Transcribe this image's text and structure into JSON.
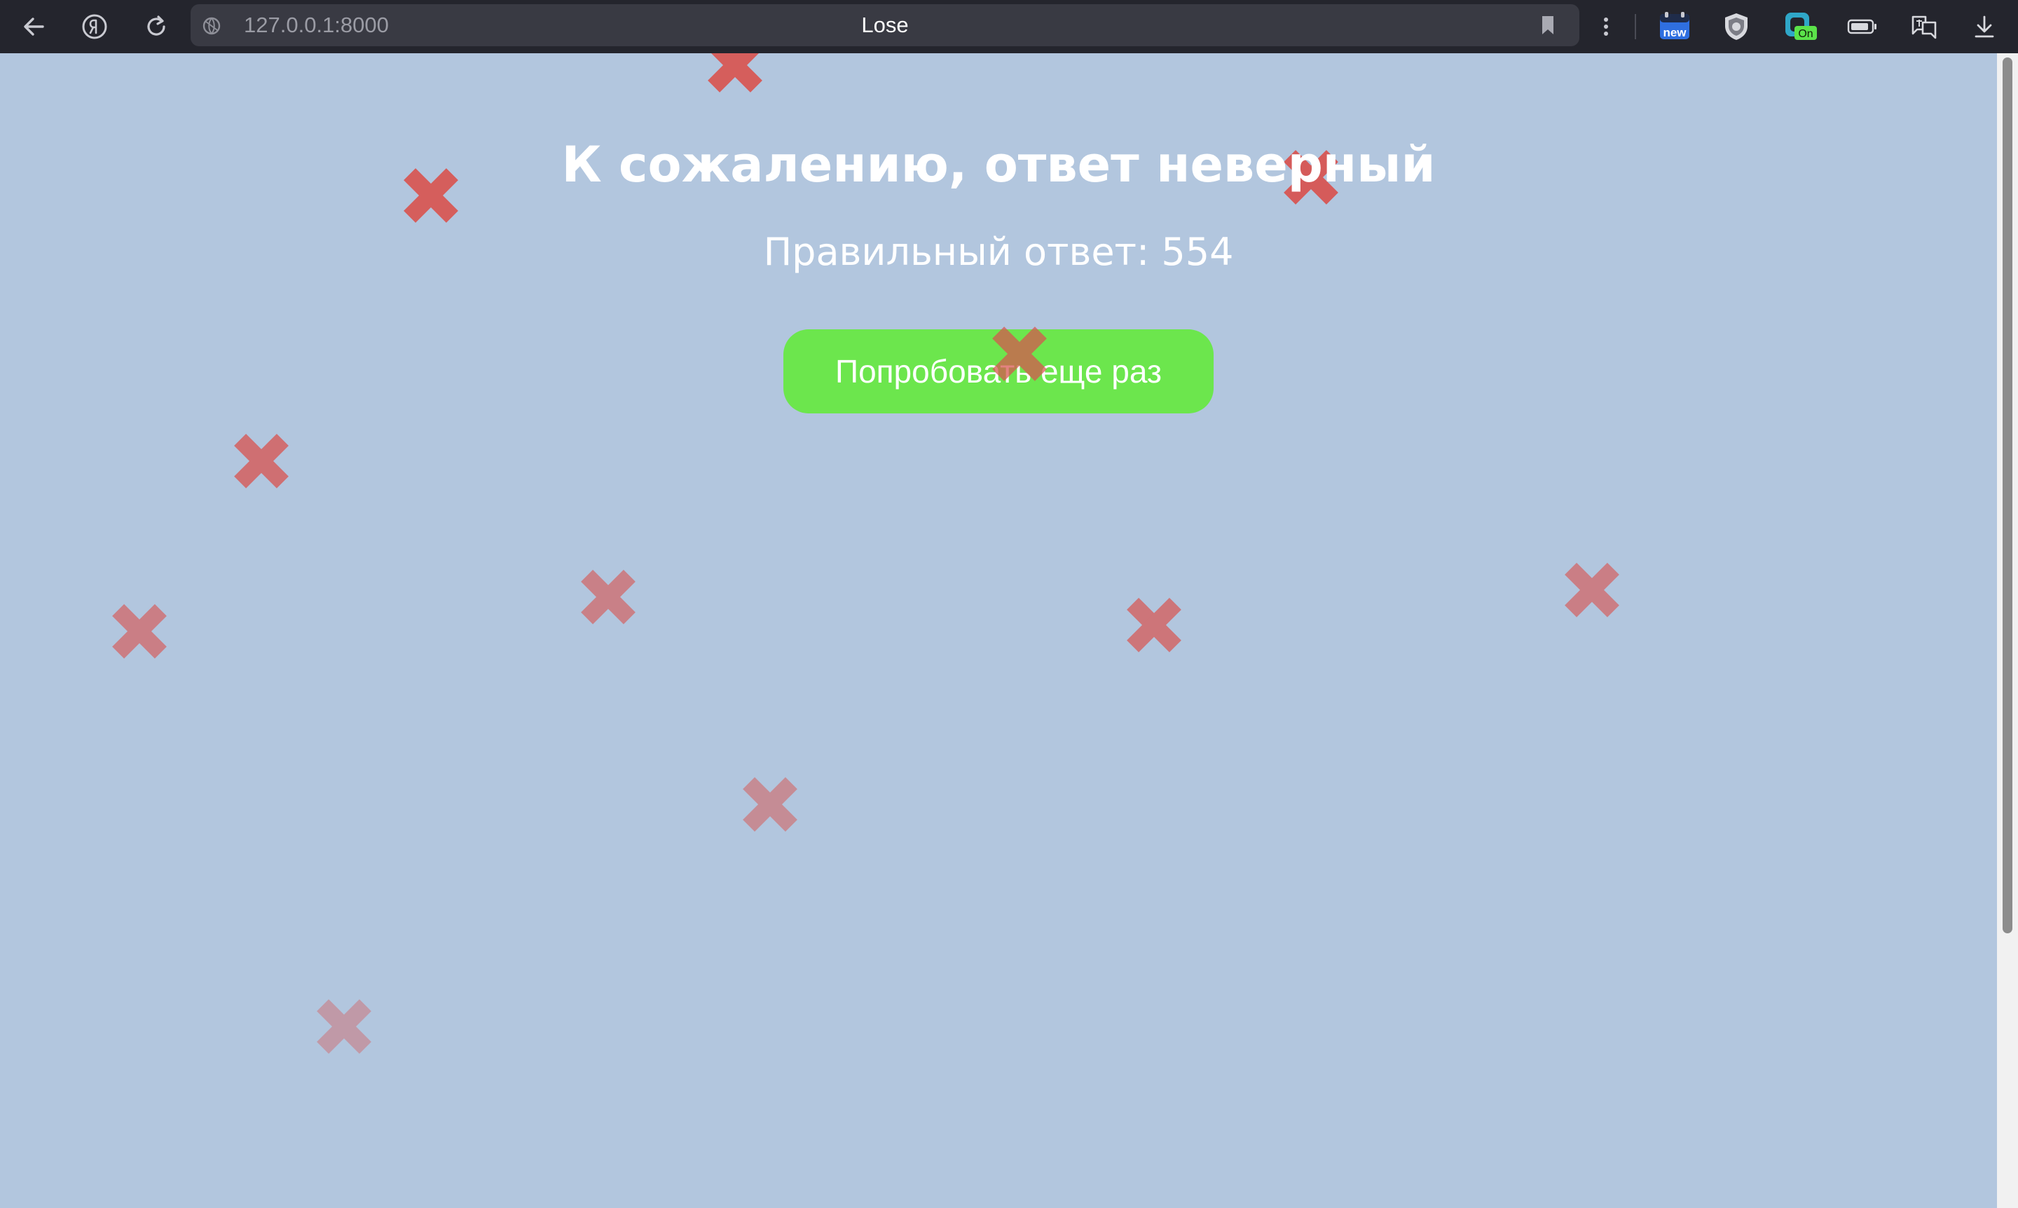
{
  "browser": {
    "url": "127.0.0.1:8000",
    "tab_title": "Lose",
    "icons": {
      "back": "arrow-left-icon",
      "yandex": "yandex-logo-icon",
      "reload": "reload-icon",
      "site": "site-info-icon",
      "bookmark": "bookmark-icon",
      "menu": "more-vertical-icon",
      "extensions": [
        "new-badge-extension-icon",
        "shield-extension-icon",
        "vpn-on-extension-icon",
        "battery-icon",
        "translate-icon",
        "download-icon"
      ]
    },
    "extension_badges": {
      "new": "new",
      "on": "On"
    }
  },
  "page": {
    "title": "К сожалению, ответ неверный",
    "correct_answer_label": "Правильный ответ: 554",
    "retry_button": "Попробовать еще раз",
    "background_color": "#b2c6de",
    "button_color": "#6ce64d",
    "cross_color": "#d9534f",
    "decoration_icon": "red-cross-icon"
  }
}
